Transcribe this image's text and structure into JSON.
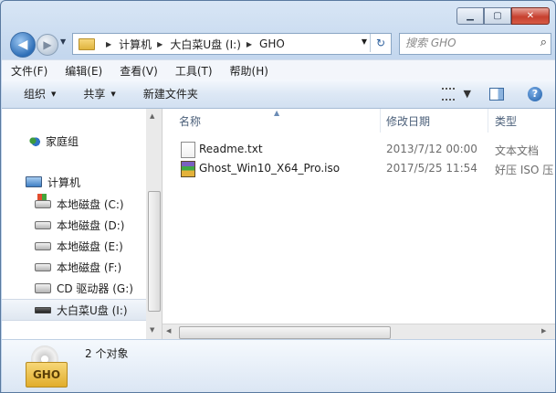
{
  "window": {
    "caption_buttons": [
      "min",
      "max",
      "close"
    ]
  },
  "address": {
    "crumbs": [
      "计算机",
      "大白菜U盘 (I:)",
      "GHO"
    ]
  },
  "search": {
    "placeholder": "搜索 GHO"
  },
  "menu": [
    "文件(F)",
    "编辑(E)",
    "查看(V)",
    "工具(T)",
    "帮助(H)"
  ],
  "toolbar": {
    "organize": "组织",
    "share": "共享",
    "new_folder": "新建文件夹"
  },
  "nav": {
    "homegroup": "家庭组",
    "computer": "计算机",
    "drives": [
      {
        "label": "本地磁盘 (C:)",
        "icon": "system-drive-icon"
      },
      {
        "label": "本地磁盘 (D:)",
        "icon": "drive-icon"
      },
      {
        "label": "本地磁盘 (E:)",
        "icon": "drive-icon"
      },
      {
        "label": "本地磁盘 (F:)",
        "icon": "drive-icon"
      },
      {
        "label": "CD 驱动器 (G:)",
        "icon": "cdrom-icon"
      },
      {
        "label": "大白菜U盘 (I:)",
        "icon": "usb-drive-icon",
        "selected": true
      }
    ]
  },
  "columns": {
    "name": "名称",
    "modified": "修改日期",
    "type": "类型"
  },
  "files": [
    {
      "name": "Readme.txt",
      "modified": "2013/7/12 00:00",
      "type": "文本文档",
      "icon": "text-file-icon"
    },
    {
      "name": "Ghost_Win10_X64_Pro.iso",
      "modified": "2017/5/25 11:54",
      "type": "好压 ISO 压",
      "icon": "iso-archive-icon"
    }
  ],
  "details": {
    "count": "2 个对象",
    "icon_label": "GHO"
  }
}
